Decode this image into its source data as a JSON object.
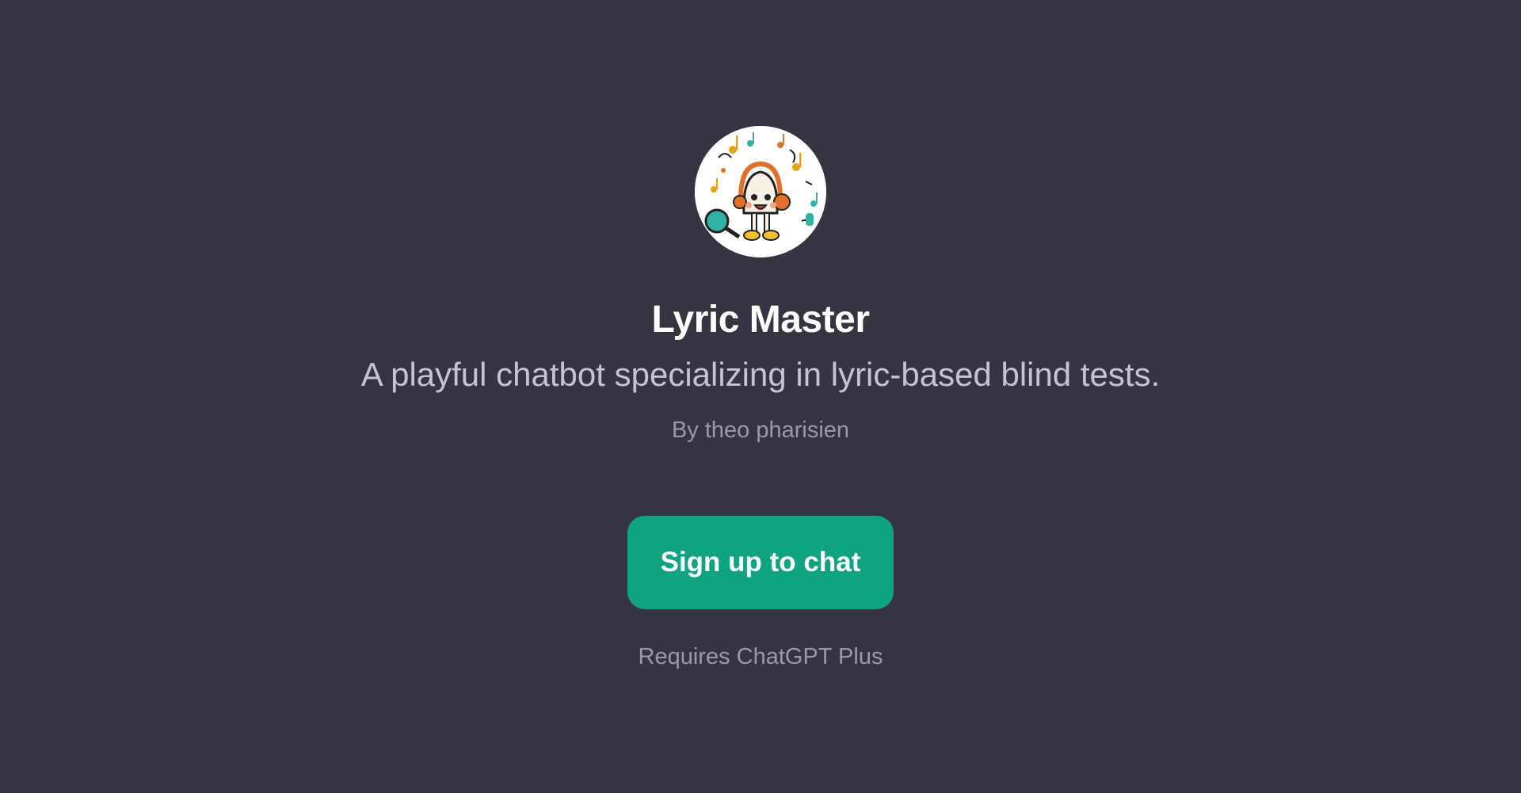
{
  "gpt": {
    "avatar_icon": "singing-character-icon",
    "name": "Lyric Master",
    "description": "A playful chatbot specializing in lyric-based blind tests.",
    "author": "By theo pharisien"
  },
  "cta": {
    "label": "Sign up to chat"
  },
  "requirement": "Requires ChatGPT Plus",
  "colors": {
    "background": "#343541",
    "accent": "#10a37f",
    "title": "#ffffff",
    "description": "#c5c5d2",
    "muted": "#9a9aa6"
  }
}
